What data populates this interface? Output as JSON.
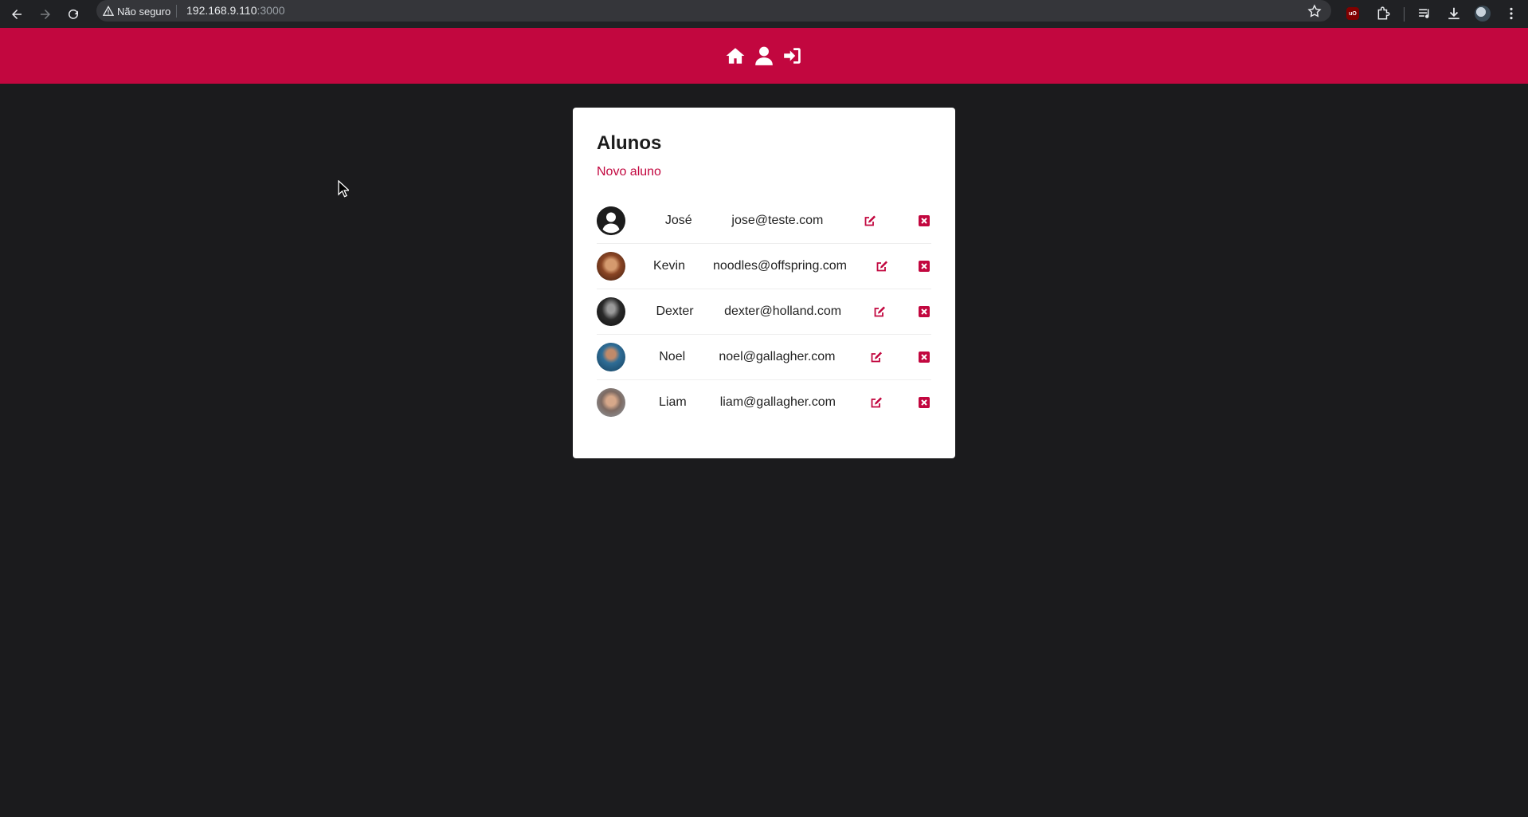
{
  "browser": {
    "security_label": "Não seguro",
    "url_host": "192.168.9.110",
    "url_port": ":3000",
    "icons": [
      "back-icon",
      "forward-icon",
      "reload-icon",
      "warning-icon",
      "star-icon",
      "ublock-icon",
      "extensions-icon",
      "media-icon",
      "download-icon",
      "profile-icon",
      "menu-icon"
    ]
  },
  "header": {
    "accent_color": "#c2073f",
    "icons": [
      "home-icon",
      "user-icon",
      "login-icon"
    ]
  },
  "page": {
    "title": "Alunos",
    "new_link": "Novo aluno"
  },
  "students": [
    {
      "name": "José",
      "email": "jose@teste.com",
      "avatar": "default-user-avatar"
    },
    {
      "name": "Kevin",
      "email": "noodles@offspring.com",
      "avatar": "photo-avatar"
    },
    {
      "name": "Dexter",
      "email": "dexter@holland.com",
      "avatar": "photo-avatar"
    },
    {
      "name": "Noel",
      "email": "noel@gallagher.com",
      "avatar": "photo-avatar"
    },
    {
      "name": "Liam",
      "email": "liam@gallagher.com",
      "avatar": "photo-avatar"
    }
  ]
}
